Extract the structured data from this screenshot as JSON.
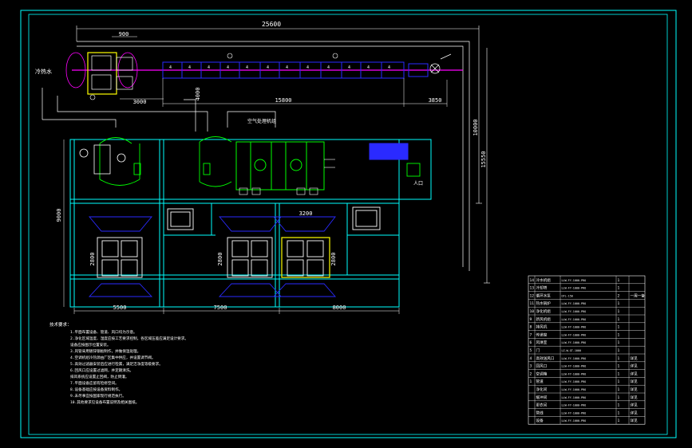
{
  "colors": {
    "background": "#000000",
    "frame": "#d4d4d4",
    "wall": "#00ffff",
    "dimension": "#ffffff",
    "equipment_green": "#00ff00",
    "equipment_blue": "#2a2aff",
    "duct_magenta": "#ff00ff",
    "highlight_yellow": "#ffff00",
    "notes_text": "#ffffff"
  },
  "dimensions": {
    "overall_width": "25600",
    "dim_900": "900",
    "dim_3000": "3000",
    "dim_4000": "4000",
    "dim_15800": "15800",
    "dim_3850": "3850",
    "dim_10000": "10000",
    "dim_15550": "15550",
    "dim_9000": "9000",
    "dim_3200": "3200",
    "dim_2800_left": "2800",
    "dim_2800_mid": "2800",
    "dim_2800_right": "2800",
    "dim_5500": "5500",
    "dim_7500": "7500",
    "dim_8000": "8000"
  },
  "labels": {
    "top_left_tag": "冷热水",
    "equipment_label": "空气处理机组",
    "corridor_tag": "人口"
  },
  "notes": {
    "heading": "技术要求：",
    "lines": [
      "1.平面布置设备、管道、风口均为示意。",
      "2.净化区域温度、湿度应按工艺要求控制，各区域压差应满足设计要求。",
      "  设备应按图示位置安装。",
      "3.风管采用镀锌钢板制作，并做保温处理。",
      "4.空调机组冷热源由厂区集中供应，并设置调节阀。",
      "5.高效过滤器安装后应进行检漏，满足洁净度等级要求。",
      "6.回风口应设置过滤网，并定期清洗。",
      "  排风系统应设置止回阀，防止倒灌。",
      "7.平面设备应留有检修空间。",
      "8.设备基础应按设备资料制作。",
      "9.未尽事宜按国家现行规范执行。",
      "10.其他要求见设备布置说明及相关图纸。"
    ]
  },
  "table": {
    "rows": [
      {
        "no": "14",
        "name": "冷水机组",
        "model": "LLW-FY-1000-PRO",
        "qty": "1",
        "note": ""
      },
      {
        "no": "13",
        "name": "冷却塔",
        "model": "LLW-FY-1000-PRO",
        "qty": "1",
        "note": ""
      },
      {
        "no": "12",
        "name": "循环水泵",
        "model": "GTL-150",
        "qty": "2",
        "note": "一用一备"
      },
      {
        "no": "11",
        "name": "热水锅炉",
        "model": "LLW-FY-1000-PRO",
        "qty": "1",
        "note": ""
      },
      {
        "no": "10",
        "name": "净化机组",
        "model": "LLW-FY-1000-PRO",
        "qty": "1",
        "note": ""
      },
      {
        "no": "9",
        "name": "新风机组",
        "model": "LLW-FY-1000-PRO",
        "qty": "1",
        "note": ""
      },
      {
        "no": "8",
        "name": "排风机",
        "model": "LLW-FY-1000-PRO",
        "qty": "1",
        "note": ""
      },
      {
        "no": "7",
        "name": "传递窗",
        "model": "LLW-FY-1000-PRO",
        "qty": "1",
        "note": ""
      },
      {
        "no": "6",
        "name": "风淋室",
        "model": "LLW-FY-1000-PRO",
        "qty": "1",
        "note": ""
      },
      {
        "no": "5",
        "name": "门",
        "model": "LZ-W-GT-1000",
        "qty": "1",
        "note": ""
      },
      {
        "no": "4",
        "name": "高效送风口",
        "model": "LLW-FY-1000-PRO",
        "qty": "1",
        "note": "详见"
      },
      {
        "no": "3",
        "name": "回风口",
        "model": "LLW-FY-1000-PRO",
        "qty": "1",
        "note": "详见"
      },
      {
        "no": "2",
        "name": "空调箱",
        "model": "LLW-FY-1000-PRO",
        "qty": "1",
        "note": "详见"
      },
      {
        "no": "1",
        "name": "管道",
        "model": "LLW-FY-1000-PRO",
        "qty": "1",
        "note": "详见"
      },
      {
        "no": "",
        "name": "净化间",
        "model": "LLW-FY-1000-PRO",
        "qty": "1",
        "note": "详见"
      },
      {
        "no": "",
        "name": "缓冲间",
        "model": "LLW-FY-1000-PRO",
        "qty": "1",
        "note": "详见"
      },
      {
        "no": "",
        "name": "更衣间",
        "model": "LLW-FY-1000-PRO",
        "qty": "1",
        "note": "详见"
      },
      {
        "no": "",
        "name": "管线",
        "model": "LLW-FY-1000-PRO",
        "qty": "1",
        "note": "详见"
      },
      {
        "no": "",
        "name": "设备",
        "model": "LLW-FY-1000-PRO",
        "qty": "1",
        "note": "详见"
      }
    ]
  }
}
